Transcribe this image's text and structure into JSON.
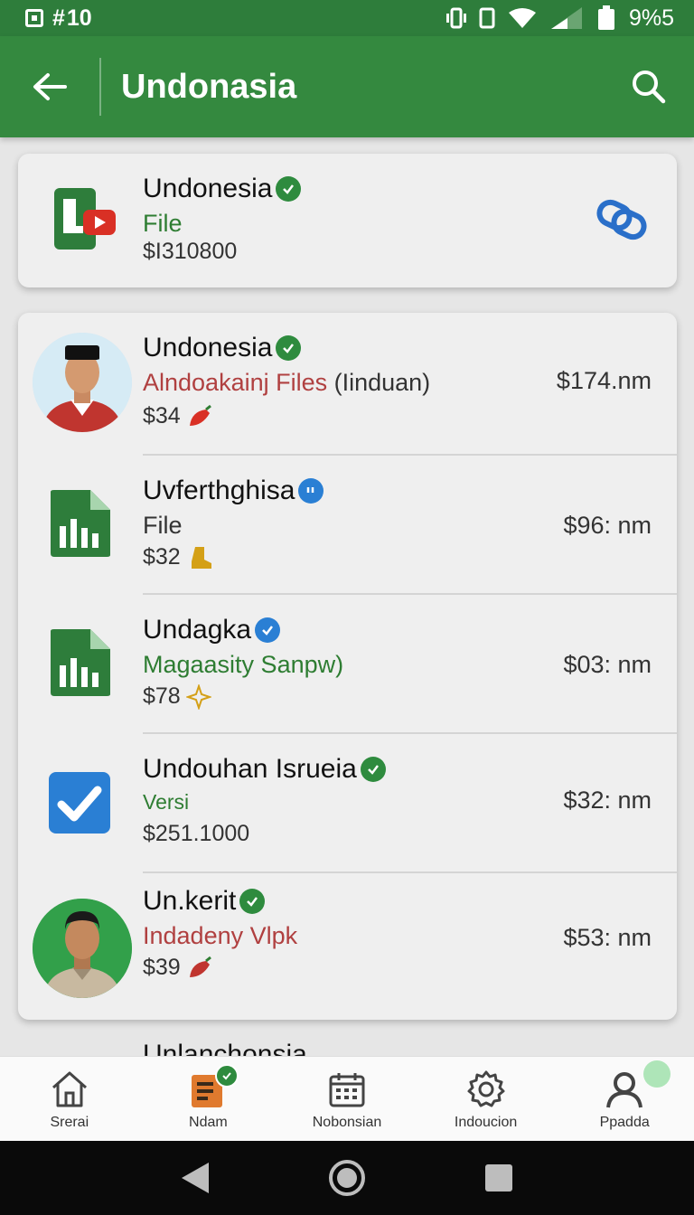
{
  "status_bar": {
    "time": "10",
    "battery": "9%5"
  },
  "app_bar": {
    "title": "Undonasia"
  },
  "top_card": {
    "title": "Undonesia",
    "subtitle": "File",
    "price": "$I310800",
    "icon": "file-video-icon",
    "action_icon": "link-icon"
  },
  "list": [
    {
      "title": "Undonesia",
      "subtitle_a": "Alndoakainj Files",
      "subtitle_b": " (Iinduan)",
      "price": "$34",
      "time": "$174.nm",
      "badge": "green",
      "lead": "avatar-man-red"
    },
    {
      "title": "Uvferthghisa",
      "subtitle": "File",
      "price": "$32",
      "time": "$96: nm",
      "badge": "blue",
      "lead": "sheet-icon"
    },
    {
      "title": "Undagka",
      "subtitle": "Magaasity Sanpw)",
      "price": "$78",
      "time": "$03: nm",
      "badge": "blue",
      "lead": "sheet-icon"
    },
    {
      "title": "Undouhan Isrueia",
      "subtitle": "Versi",
      "price": "$251.1000",
      "time": "$32: nm",
      "badge": "green",
      "lead": "checkbox-icon"
    },
    {
      "title": "Un.kerit",
      "subtitle": "Indadeny Vlpk",
      "price": "$39",
      "time": "$53: nm",
      "badge": "green",
      "lead": "avatar-man-green"
    }
  ],
  "peek_title": "Unlanchonsia",
  "bottom_nav": [
    {
      "label": "Srerai",
      "icon": "home-icon"
    },
    {
      "label": "Ndam",
      "icon": "document-icon"
    },
    {
      "label": "Nobonsian",
      "icon": "calendar-icon"
    },
    {
      "label": "Indoucion",
      "icon": "gear-icon"
    },
    {
      "label": "Ppadda",
      "icon": "person-icon"
    }
  ],
  "colors": {
    "primary": "#34893f",
    "status": "#2e7d3b",
    "accent_green": "#2e7d32",
    "accent_red": "#b04040",
    "badge_blue": "#2a7fd4"
  }
}
